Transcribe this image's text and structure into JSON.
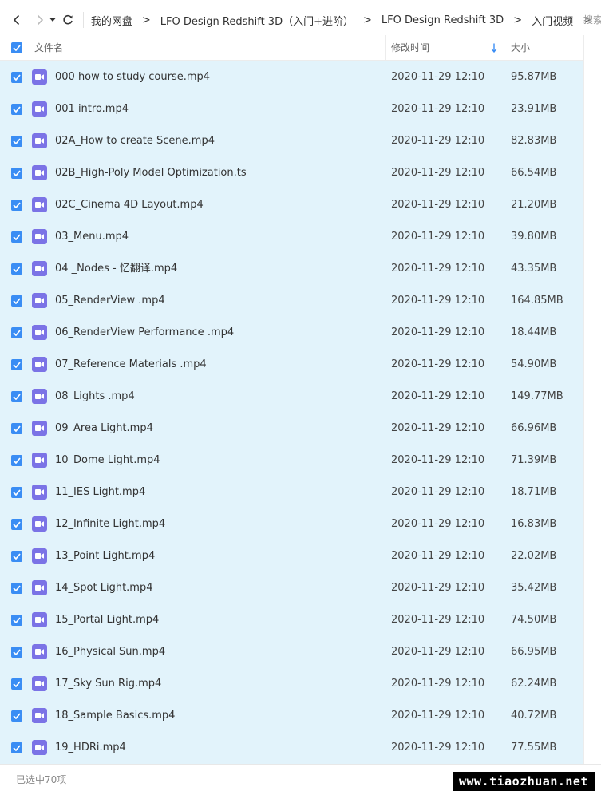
{
  "toolbar": {
    "breadcrumb": [
      "我的网盘",
      "LFO Design Redshift 3D（入门+进阶）",
      "LFO Design Redshift 3D",
      "入门视频"
    ],
    "separator": ">",
    "search_placeholder": "搜索"
  },
  "header": {
    "name": "文件名",
    "time": "修改时间",
    "size": "大小"
  },
  "files": [
    {
      "name": "000 how to study course.mp4",
      "time": "2020-11-29 12:10",
      "size": "95.87MB"
    },
    {
      "name": "001 intro.mp4",
      "time": "2020-11-29 12:10",
      "size": "23.91MB"
    },
    {
      "name": "02A_How to create Scene.mp4",
      "time": "2020-11-29 12:10",
      "size": "82.83MB"
    },
    {
      "name": "02B_High-Poly Model Optimization.ts",
      "time": "2020-11-29 12:10",
      "size": "66.54MB"
    },
    {
      "name": "02C_Cinema 4D Layout.mp4",
      "time": "2020-11-29 12:10",
      "size": "21.20MB"
    },
    {
      "name": "03_Menu.mp4",
      "time": "2020-11-29 12:10",
      "size": "39.80MB"
    },
    {
      "name": "04 _Nodes - 忆翻译.mp4",
      "time": "2020-11-29 12:10",
      "size": "43.35MB"
    },
    {
      "name": "05_RenderView .mp4",
      "time": "2020-11-29 12:10",
      "size": "164.85MB"
    },
    {
      "name": "06_RenderView Performance .mp4",
      "time": "2020-11-29 12:10",
      "size": "18.44MB"
    },
    {
      "name": "07_Reference Materials .mp4",
      "time": "2020-11-29 12:10",
      "size": "54.90MB"
    },
    {
      "name": "08_Lights .mp4",
      "time": "2020-11-29 12:10",
      "size": "149.77MB"
    },
    {
      "name": "09_Area Light.mp4",
      "time": "2020-11-29 12:10",
      "size": "66.96MB"
    },
    {
      "name": "10_Dome Light.mp4",
      "time": "2020-11-29 12:10",
      "size": "71.39MB"
    },
    {
      "name": "11_IES Light.mp4",
      "time": "2020-11-29 12:10",
      "size": "18.71MB"
    },
    {
      "name": "12_Infinite Light.mp4",
      "time": "2020-11-29 12:10",
      "size": "16.83MB"
    },
    {
      "name": "13_Point Light.mp4",
      "time": "2020-11-29 12:10",
      "size": "22.02MB"
    },
    {
      "name": "14_Spot Light.mp4",
      "time": "2020-11-29 12:10",
      "size": "35.42MB"
    },
    {
      "name": "15_Portal Light.mp4",
      "time": "2020-11-29 12:10",
      "size": "74.50MB"
    },
    {
      "name": "16_Physical Sun.mp4",
      "time": "2020-11-29 12:10",
      "size": "66.95MB"
    },
    {
      "name": "17_Sky Sun Rig.mp4",
      "time": "2020-11-29 12:10",
      "size": "62.24MB"
    },
    {
      "name": "18_Sample Basics.mp4",
      "time": "2020-11-29 12:10",
      "size": "40.72MB"
    },
    {
      "name": "19_HDRi.mp4",
      "time": "2020-11-29 12:10",
      "size": "77.55MB"
    }
  ],
  "status": {
    "selected_text": "已选中70项"
  },
  "watermark": "www.tiaozhuan.net",
  "colors": {
    "accent": "#3a8df4",
    "selected_row": "#e2f3fb",
    "video_icon": "#7b73e6"
  }
}
